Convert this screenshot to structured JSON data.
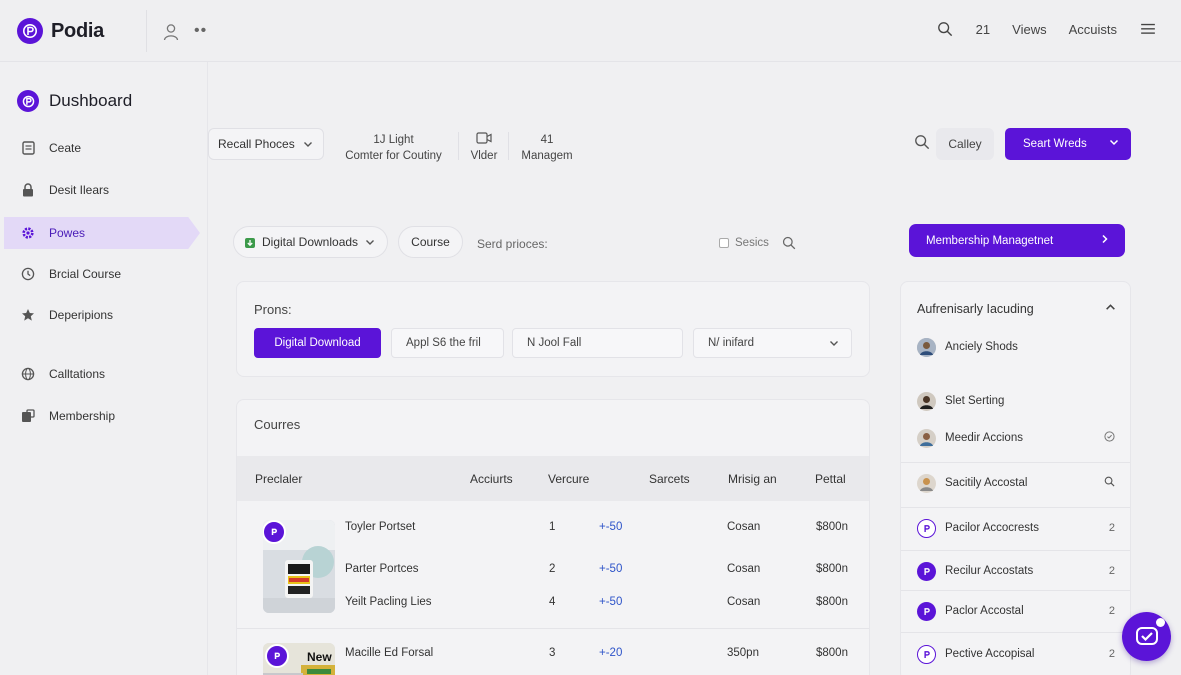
{
  "brand": {
    "name": "Podia",
    "color": "#5b14d8"
  },
  "topbar": {
    "count": "21",
    "views": "Views",
    "accounts": "Accuists"
  },
  "sidebar": {
    "title": "Dushboard",
    "items": [
      {
        "label": "Ceate",
        "icon": "document-icon"
      },
      {
        "label": "Desit Ilears",
        "icon": "lock-icon"
      },
      {
        "label": "Powes",
        "icon": "gear-icon",
        "active": true
      },
      {
        "label": "Brcial Course",
        "icon": "clock-icon"
      },
      {
        "label": "Deperipions",
        "icon": "star-icon"
      },
      {
        "label": "Calltations",
        "icon": "globe-icon"
      },
      {
        "label": "Membership",
        "icon": "badge-icon"
      }
    ]
  },
  "filters": {
    "dropdown": "Recall Phoces",
    "stat1": {
      "top": "1J Light",
      "bottom": "Comter for Coutiny"
    },
    "stat2": {
      "bottom": "Vlder"
    },
    "stat3": {
      "top": "41",
      "bottom": "Managem"
    },
    "callby": "Calley",
    "primary_button": "Seart Wreds"
  },
  "row2": {
    "digital_downloads": "Digital Downloads",
    "course": "Course",
    "send_label": "Serd prioces:",
    "checkbox": "Sesics",
    "membership_button": "Membership Managetnet"
  },
  "prons": {
    "title": "Prons:",
    "chips": [
      "Digital Download",
      "Appl S6 the fril",
      "N Jool Fall",
      "N/ inifard"
    ]
  },
  "courses": {
    "title": "Courres",
    "columns": [
      "Preclaler",
      "Acciurts",
      "Vercure",
      "Sarcets",
      "Mrisig an",
      "Pettal"
    ],
    "rows": [
      {
        "name": "Toyler Portset",
        "num": "1",
        "delta": "+-50",
        "type": "Cosan",
        "price": "$800n"
      },
      {
        "name": "Parter Portces",
        "num": "2",
        "delta": "+-50",
        "type": "Cosan",
        "price": "$800n"
      },
      {
        "name": "Yeilt Pacling Lies",
        "num": "4",
        "delta": "+-50",
        "type": "Cosan",
        "price": "$800n"
      },
      {
        "name": "Macille Ed Forsal",
        "num": "3",
        "delta": "+-20",
        "type": "350pn",
        "price": "$800n"
      }
    ],
    "thumb2_text": "New"
  },
  "right_panel": {
    "title": "Aufrenisarly Iacuding",
    "items": [
      {
        "label": "Anciely Shods",
        "avatar": "person-avatar",
        "tail": ""
      },
      {
        "label": "Slet Serting",
        "avatar": "person-avatar",
        "tail": ""
      },
      {
        "label": "Meedir Accions",
        "avatar": "person-avatar",
        "tail": "check-circle-icon"
      },
      {
        "label": "Sacitily Accostal",
        "avatar": "person-avatar",
        "tail": "search-icon"
      },
      {
        "label": "Pacilor Accocrests",
        "avatar": "podia-logo",
        "tail": "2"
      },
      {
        "label": "Recilur Accostats",
        "avatar": "podia-logo",
        "tail": "2"
      },
      {
        "label": "Paclor Accostal",
        "avatar": "podia-logo",
        "tail": "2"
      },
      {
        "label": "Pective Accopisal",
        "avatar": "podia-logo",
        "tail": "2"
      }
    ]
  }
}
